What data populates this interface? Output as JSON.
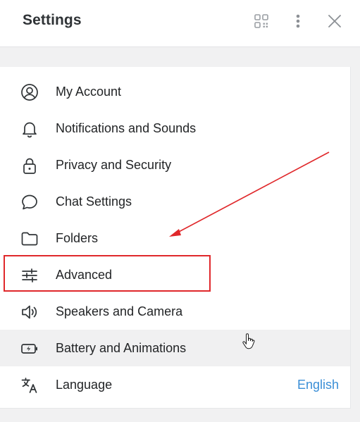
{
  "header": {
    "title": "Settings",
    "qr_icon": "qr-code-icon",
    "more_icon": "more-vertical-icon",
    "close_icon": "close-icon"
  },
  "items": [
    {
      "label": "My Account",
      "icon": "user-circle-icon",
      "value": ""
    },
    {
      "label": "Notifications and Sounds",
      "icon": "bell-icon",
      "value": ""
    },
    {
      "label": "Privacy and Security",
      "icon": "lock-icon",
      "value": ""
    },
    {
      "label": "Chat Settings",
      "icon": "chat-bubble-icon",
      "value": ""
    },
    {
      "label": "Folders",
      "icon": "folder-icon",
      "value": ""
    },
    {
      "label": "Advanced",
      "icon": "sliders-icon",
      "value": ""
    },
    {
      "label": "Speakers and Camera",
      "icon": "speaker-icon",
      "value": ""
    },
    {
      "label": "Battery and Animations",
      "icon": "battery-icon",
      "value": ""
    },
    {
      "label": "Language",
      "icon": "translate-icon",
      "value": "English"
    }
  ],
  "colors": {
    "accent": "#3a8ed6",
    "annotation": "#e0282b",
    "hover_row": "#f0f0f1"
  }
}
